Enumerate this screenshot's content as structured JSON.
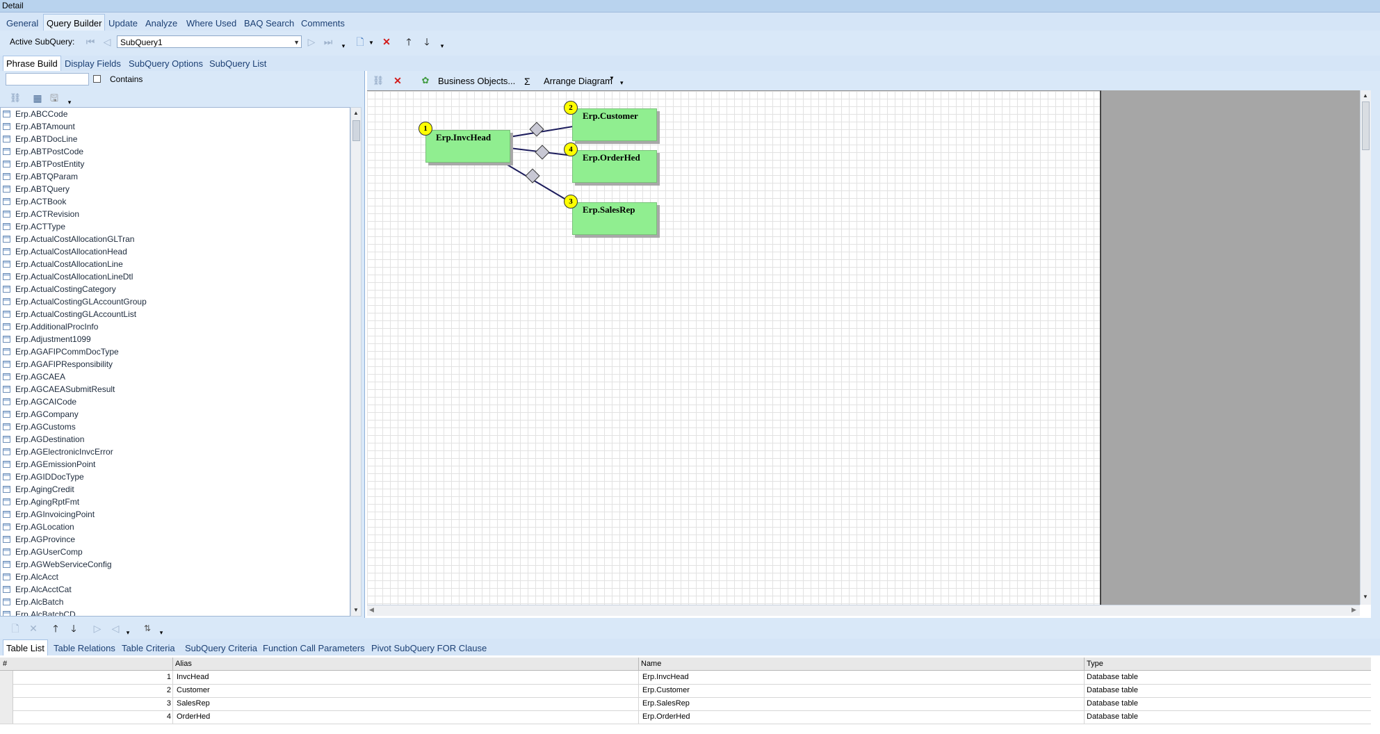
{
  "window": {
    "title": "Detail"
  },
  "top_tabs": [
    "General",
    "Query Builder",
    "Update",
    "Analyze",
    "Where Used",
    "BAQ Search",
    "Comments"
  ],
  "subquery_toolbar": {
    "label": "Active SubQuery:",
    "selected": "SubQuery1"
  },
  "sub_tabs": [
    "Phrase Build",
    "Display Fields",
    "SubQuery Options",
    "SubQuery List"
  ],
  "filter": {
    "value": "",
    "contains_label": "Contains",
    "contains_checked": false
  },
  "table_list": [
    "Erp.ABCCode",
    "Erp.ABTAmount",
    "Erp.ABTDocLine",
    "Erp.ABTPostCode",
    "Erp.ABTPostEntity",
    "Erp.ABTQParam",
    "Erp.ABTQuery",
    "Erp.ACTBook",
    "Erp.ACTRevision",
    "Erp.ACTType",
    "Erp.ActualCostAllocationGLTran",
    "Erp.ActualCostAllocationHead",
    "Erp.ActualCostAllocationLine",
    "Erp.ActualCostAllocationLineDtl",
    "Erp.ActualCostingCategory",
    "Erp.ActualCostingGLAccountGroup",
    "Erp.ActualCostingGLAccountList",
    "Erp.AdditionalProcInfo",
    "Erp.Adjustment1099",
    "Erp.AGAFIPCommDocType",
    "Erp.AGAFIPResponsibility",
    "Erp.AGCAEA",
    "Erp.AGCAEASubmitResult",
    "Erp.AGCAICode",
    "Erp.AGCompany",
    "Erp.AGCustoms",
    "Erp.AGDestination",
    "Erp.AGElectronicInvcError",
    "Erp.AGEmissionPoint",
    "Erp.AGIDDocType",
    "Erp.AgingCredit",
    "Erp.AgingRptFmt",
    "Erp.AGInvoicingPoint",
    "Erp.AGLocation",
    "Erp.AGProvince",
    "Erp.AGUserComp",
    "Erp.AGWebServiceConfig",
    "Erp.AlcAcct",
    "Erp.AlcAcctCat",
    "Erp.AlcBatch",
    "Erp.AlcBatchCD"
  ],
  "diagram_toolbar": {
    "business_objects": "Business Objects...",
    "sum_symbol": "Σ",
    "arrange": "Arrange Diagram"
  },
  "diagram_nodes": [
    {
      "num": "1",
      "name": "Erp.InvcHead"
    },
    {
      "num": "2",
      "name": "Erp.Customer"
    },
    {
      "num": "4",
      "name": "Erp.OrderHed"
    },
    {
      "num": "3",
      "name": "Erp.SalesRep"
    }
  ],
  "bottom_tabs": [
    "Table List",
    "Table Relations",
    "Table Criteria",
    "SubQuery Criteria",
    "Function Call Parameters",
    "Pivot SubQuery FOR Clause"
  ],
  "grid": {
    "headers": {
      "num": "#",
      "alias": "Alias",
      "name": "Name",
      "type": "Type"
    },
    "rows": [
      {
        "num": "1",
        "alias": "InvcHead",
        "name": "Erp.InvcHead",
        "type": "Database table"
      },
      {
        "num": "2",
        "alias": "Customer",
        "name": "Erp.Customer",
        "type": "Database table"
      },
      {
        "num": "3",
        "alias": "SalesRep",
        "name": "Erp.SalesRep",
        "type": "Database table"
      },
      {
        "num": "4",
        "alias": "OrderHed",
        "name": "Erp.OrderHed",
        "type": "Database table"
      }
    ]
  },
  "colors": {
    "node_fill": "#90ee90",
    "badge": "#ffff00",
    "panel": "#d9e8f8",
    "delete_red": "#d21a1a"
  }
}
